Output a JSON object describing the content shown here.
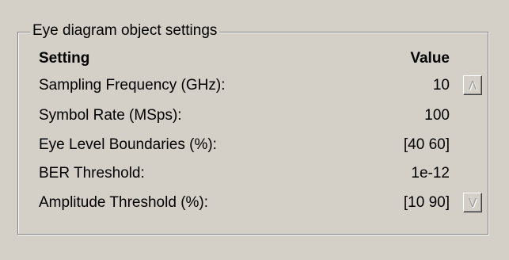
{
  "group": {
    "title": "Eye diagram object settings"
  },
  "table": {
    "headers": {
      "setting": "Setting",
      "value": "Value"
    },
    "rows": [
      {
        "label": "Sampling Frequency (GHz):",
        "value": "10"
      },
      {
        "label": "Symbol Rate (MSps):",
        "value": "100"
      },
      {
        "label": "Eye Level Boundaries (%):",
        "value": "[40 60]"
      },
      {
        "label": "BER Threshold:",
        "value": "1e-12"
      },
      {
        "label": "Amplitude Threshold (%):",
        "value": "[10 90]"
      }
    ]
  },
  "scroll": {
    "up_icon": "up-arrow-icon",
    "down_icon": "down-arrow-icon",
    "up_glyph": "Λ",
    "down_glyph": "V",
    "enabled": false
  }
}
